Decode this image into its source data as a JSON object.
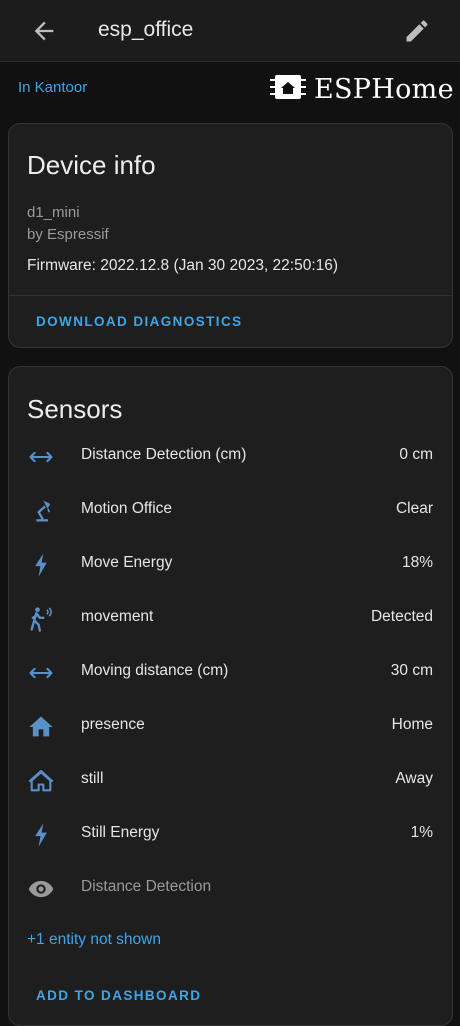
{
  "header": {
    "title": "esp_office",
    "back_icon": "arrow-left-icon",
    "edit_icon": "pencil-icon"
  },
  "area": {
    "label": "In Kantoor"
  },
  "brand": {
    "name": "ESPHome",
    "icon": "esphome-chip-icon"
  },
  "device_info": {
    "title": "Device info",
    "model": "d1_mini",
    "manufacturer": "by Espressif",
    "firmware": "Firmware: 2022.12.8 (Jan 30 2023, 22:50:16)",
    "action": "DOWNLOAD DIAGNOSTICS"
  },
  "sensors": {
    "title": "Sensors",
    "items": [
      {
        "icon": "arrow-left-right-icon",
        "name": "Distance Detection (cm)",
        "value": "0 cm"
      },
      {
        "icon": "desk-lamp-icon",
        "name": "Motion Office",
        "value": "Clear"
      },
      {
        "icon": "flash-icon",
        "name": "Move Energy",
        "value": "18%"
      },
      {
        "icon": "motion-sensor-icon",
        "name": "movement",
        "value": "Detected"
      },
      {
        "icon": "arrow-left-right-icon",
        "name": "Moving distance (cm)",
        "value": "30 cm"
      },
      {
        "icon": "home-icon",
        "name": "presence",
        "value": "Home"
      },
      {
        "icon": "home-outline-icon",
        "name": "still",
        "value": "Away"
      },
      {
        "icon": "flash-icon",
        "name": "Still Energy",
        "value": "1%"
      },
      {
        "icon": "eye-icon",
        "name": "Distance Detection",
        "value": ""
      }
    ],
    "more": "+1 entity not shown",
    "action": "ADD TO DASHBOARD"
  },
  "colors": {
    "accent": "#3ea6e8",
    "icon": "#5b8fc7",
    "background": "#111111",
    "card": "#1e1e1e"
  }
}
